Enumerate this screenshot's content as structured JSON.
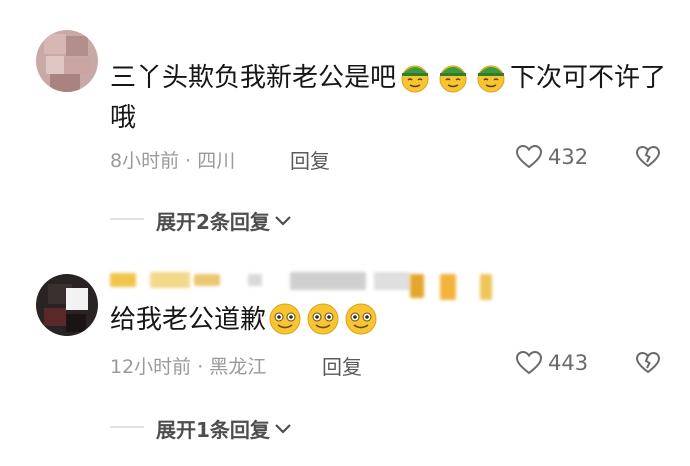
{
  "comments": [
    {
      "text_before": "三丫头欺负我新老公是吧",
      "text_after": "下次可不许了哦",
      "emojis": [
        "helmet-smile-emoji",
        "helmet-smile-emoji",
        "helmet-smile-emoji"
      ],
      "time": "8小时前",
      "dot": "·",
      "location": "四川",
      "reply_label": "回复",
      "likes": "432",
      "expand_label": "展开2条回复"
    },
    {
      "text_before": "给我老公道歉",
      "emojis": [
        "smile-emoji",
        "smile-emoji",
        "smile-emoji"
      ],
      "time": "12小时前",
      "dot": "·",
      "location": "黑龙江",
      "reply_label": "回复",
      "likes": "443",
      "expand_label": "展开1条回复"
    }
  ],
  "colors": {
    "emoji_yellow": "#f7c531",
    "helmet_green": "#3f9a3d",
    "meta_gray": "#9a9a9a"
  }
}
